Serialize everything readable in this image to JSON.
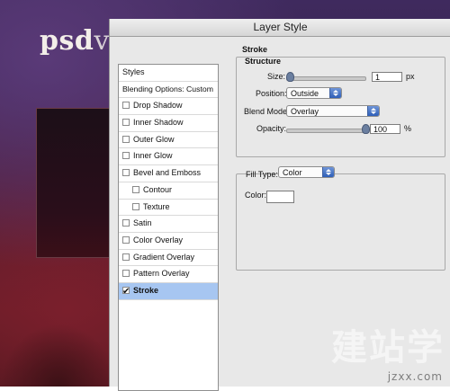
{
  "background": {
    "logo_text": "psd",
    "logo_tail": "v"
  },
  "dialog": {
    "title": "Layer Style",
    "styles_list": {
      "header": "Styles",
      "blending": "Blending Options: Custom",
      "items": [
        {
          "label": "Drop Shadow",
          "checked": false,
          "sub": false
        },
        {
          "label": "Inner Shadow",
          "checked": false,
          "sub": false
        },
        {
          "label": "Outer Glow",
          "checked": false,
          "sub": false
        },
        {
          "label": "Inner Glow",
          "checked": false,
          "sub": false
        },
        {
          "label": "Bevel and Emboss",
          "checked": false,
          "sub": false
        },
        {
          "label": "Contour",
          "checked": false,
          "sub": true
        },
        {
          "label": "Texture",
          "checked": false,
          "sub": true
        },
        {
          "label": "Satin",
          "checked": false,
          "sub": false
        },
        {
          "label": "Color Overlay",
          "checked": false,
          "sub": false
        },
        {
          "label": "Gradient Overlay",
          "checked": false,
          "sub": false
        },
        {
          "label": "Pattern Overlay",
          "checked": false,
          "sub": false
        },
        {
          "label": "Stroke",
          "checked": true,
          "sub": false,
          "selected": true
        }
      ]
    },
    "stroke": {
      "group_title": "Stroke",
      "structure_title": "Structure",
      "size_label": "Size:",
      "size_value": "1",
      "size_unit": "px",
      "position_label": "Position:",
      "position_value": "Outside",
      "blend_mode_label": "Blend Mode:",
      "blend_mode_value": "Overlay",
      "opacity_label": "Opacity:",
      "opacity_value": "100",
      "opacity_unit": "%",
      "fill_type_label": "Fill Type:",
      "fill_type_value": "Color",
      "color_label": "Color:",
      "color_value": "#ffffff"
    }
  },
  "watermark": {
    "big": "建站学",
    "small": "jzxx.com"
  }
}
